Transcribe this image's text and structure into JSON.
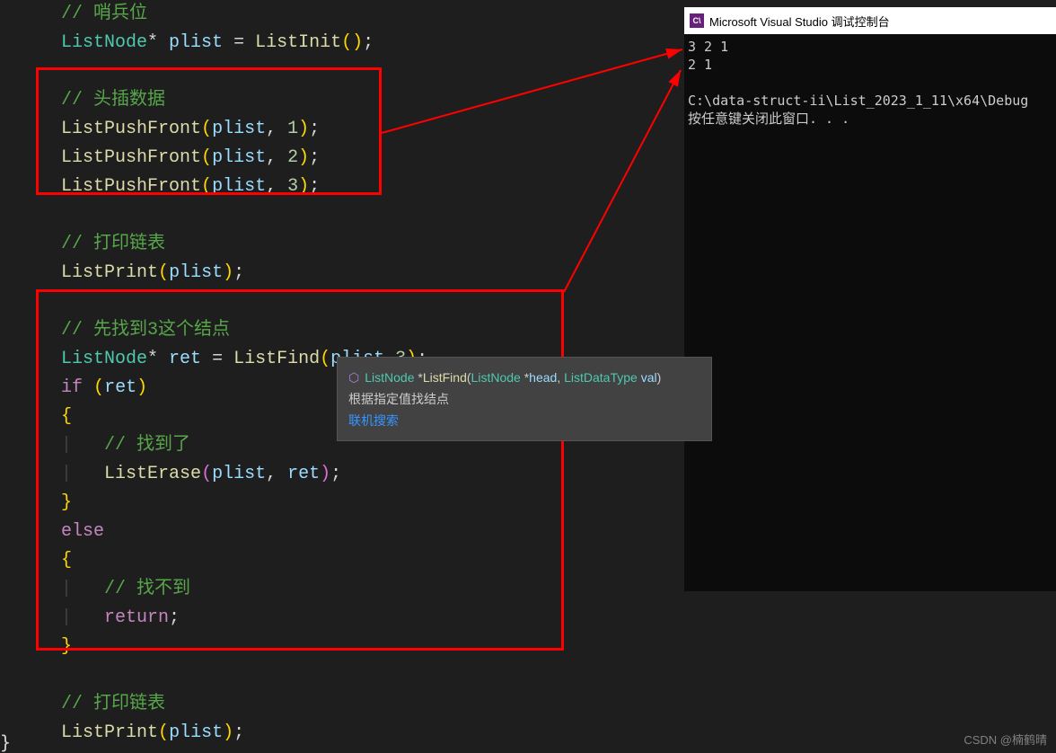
{
  "code": {
    "l0_comment": "// 哨兵位",
    "l1_type": "ListNode",
    "l1_star": "* ",
    "l1_var": "plist",
    "l1_eq": " = ",
    "l1_func": "ListInit",
    "l1_parens": "()",
    "l1_semi": ";",
    "l3_comment": "// 头插数据",
    "push_func": "ListPushFront",
    "push_arg_var": "plist",
    "push_comma": ", ",
    "push_1": "1",
    "push_2": "2",
    "push_3": "3",
    "paren_open": "(",
    "paren_close": ")",
    "semi": ";",
    "l8_comment": "// 打印链表",
    "print_func": "ListPrint",
    "l11_comment": "// 先找到3这个结点",
    "l12_var": "ret",
    "find_func": "ListFind",
    "find_arg2": "3",
    "if_kw": "if",
    "else_kw": "else",
    "l14_open": "{",
    "l15_comment": "// 找到了",
    "erase_func": "ListErase",
    "l17_close": "}",
    "l20_comment": "// 找不到",
    "return_kw": "return",
    "l24_comment": "// 打印链表",
    "final_close": "}"
  },
  "tooltip": {
    "ret_type": "ListNode",
    "star": " *",
    "func_name": "ListFind",
    "param1_type": "ListNode",
    "param1_name": "head",
    "param2_type": "ListDataType",
    "param2_name": "val",
    "desc": "根据指定值找结点",
    "link": "联机搜索"
  },
  "console": {
    "title": "Microsoft Visual Studio 调试控制台",
    "line1": "3 2 1",
    "line2": "2 1",
    "line4": "C:\\data-struct-ii\\List_2023_1_11\\x64\\Debug",
    "line5": "按任意键关闭此窗口. . ."
  },
  "watermark": "CSDN @楠鹤晴"
}
